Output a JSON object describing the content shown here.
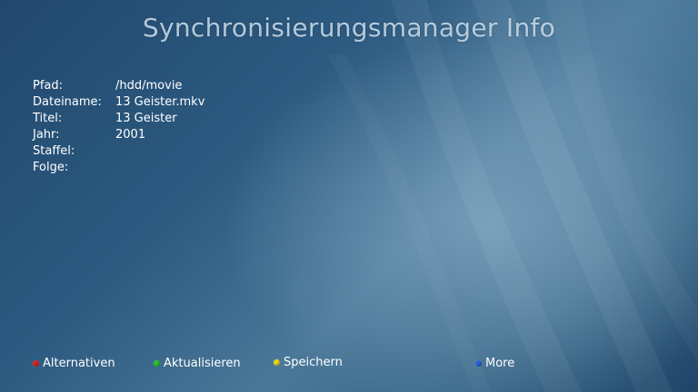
{
  "header": {
    "title": "Synchronisierungsmanager Info"
  },
  "info": {
    "rows": [
      {
        "label": "Pfad:",
        "value": "/hdd/movie"
      },
      {
        "label": "Dateiname:",
        "value": "13 Geister.mkv"
      },
      {
        "label": "Titel:",
        "value": "13 Geister"
      },
      {
        "label": "Jahr:",
        "value": "2001"
      },
      {
        "label": "Staffel:",
        "value": ""
      },
      {
        "label": "Folge:",
        "value": ""
      }
    ]
  },
  "buttons": {
    "red": {
      "label": "Alternativen",
      "color": "#d81e1e"
    },
    "green": {
      "label": "Aktualisieren",
      "color": "#27c227"
    },
    "yellow": {
      "label": "Speichern",
      "color": "#e6d21a"
    },
    "blue": {
      "label": "More",
      "color": "#2a5fd8"
    }
  }
}
